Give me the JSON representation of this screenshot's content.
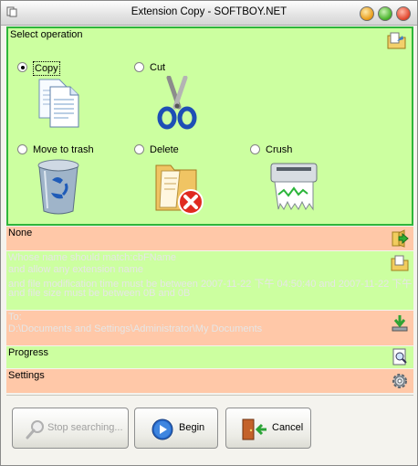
{
  "window": {
    "title": "Extension Copy  - SOFTBOY.NET"
  },
  "operations": {
    "title": "Select operation",
    "options": [
      {
        "label": "Copy",
        "selected": true,
        "icon": "copy-documents-icon"
      },
      {
        "label": "Cut",
        "selected": false,
        "icon": "scissors-icon"
      },
      {
        "label": "Move to trash",
        "selected": false,
        "icon": "recycle-bin-icon"
      },
      {
        "label": "Delete",
        "selected": false,
        "icon": "delete-folder-icon"
      },
      {
        "label": "Crush",
        "selected": false,
        "icon": "shredder-icon"
      }
    ]
  },
  "sections": {
    "source": {
      "label": "None"
    },
    "filter": {
      "lines": [
        "Whose name should match:cbFName",
        "and allow any extension name",
        "and file modification time must be between 2007-11-22 下午 04:50:40 and 2007-11-22 下午",
        "and file size must be between 0B and 0B"
      ]
    },
    "destination": {
      "lines": [
        "To:",
        "D:\\Documents and Settings\\Administrator\\My Documents"
      ]
    },
    "progress": {
      "label": "Progress"
    },
    "settings": {
      "label": "Settings"
    }
  },
  "buttons": {
    "stop": "Stop searching...",
    "begin": "Begin",
    "cancel": "Cancel"
  },
  "colors": {
    "op_panel_bg": "#ccffa0",
    "op_panel_border": "#2fb63a",
    "salmon_row": "#ffc8a8",
    "green_row": "#ccffa0"
  }
}
